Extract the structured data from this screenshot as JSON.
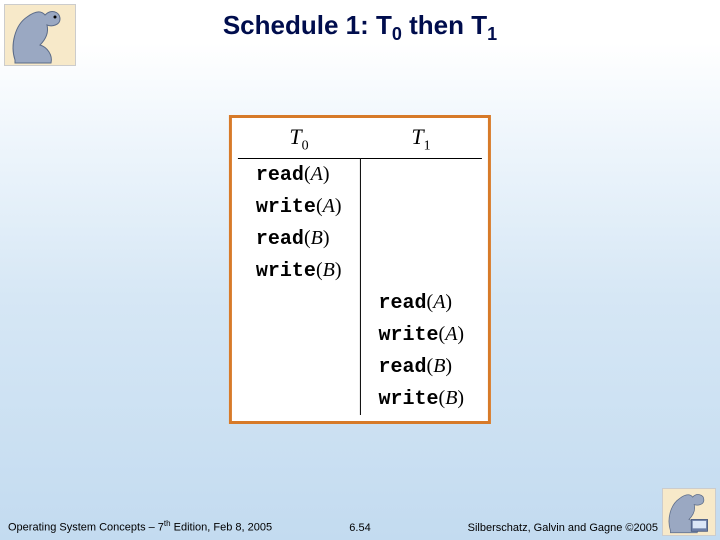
{
  "title": {
    "prefix": "Schedule 1: T",
    "sub0": "0",
    "mid": " then T",
    "sub1": "1"
  },
  "schedule": {
    "headers": {
      "c0": "T",
      "c0_sub": "0",
      "c1": "T",
      "c1_sub": "1"
    },
    "ops": {
      "read": "read",
      "write": "write",
      "lp": "(",
      "rp": ")",
      "A": "A",
      "B": "B"
    }
  },
  "chart_data": {
    "type": "table",
    "title": "Schedule 1: T0 then T1",
    "columns": [
      "T0",
      "T1"
    ],
    "rows": [
      [
        "read(A)",
        ""
      ],
      [
        "write(A)",
        ""
      ],
      [
        "read(B)",
        ""
      ],
      [
        "write(B)",
        ""
      ],
      [
        "",
        "read(A)"
      ],
      [
        "",
        "write(A)"
      ],
      [
        "",
        "read(B)"
      ],
      [
        "",
        "write(B)"
      ]
    ]
  },
  "footer": {
    "left_a": "Operating System Concepts – 7",
    "left_sup": "th",
    "left_b": " Edition, Feb 8, 2005",
    "center": "6.54",
    "right": "Silberschatz, Galvin and Gagne ©2005"
  }
}
